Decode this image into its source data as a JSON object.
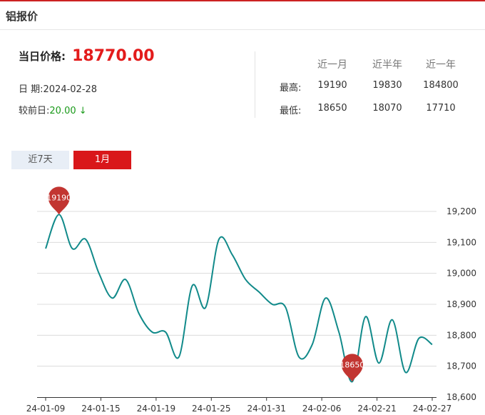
{
  "header": {
    "title": "铝报价"
  },
  "price": {
    "label": "当日价格:",
    "value": "18770.00"
  },
  "date_row": {
    "label": "日 期:",
    "value": "2024-02-28"
  },
  "change_row": {
    "label": "较前日:",
    "value": "20.00 ↓"
  },
  "stats": {
    "headers": [
      "近一月",
      "近半年",
      "近一年"
    ],
    "rows": [
      {
        "label": "最高:",
        "values": [
          "19190",
          "19830",
          "184800"
        ]
      },
      {
        "label": "最低:",
        "values": [
          "18650",
          "18070",
          "17710"
        ]
      }
    ]
  },
  "tabs": [
    {
      "label": "近7天",
      "active": false
    },
    {
      "label": "1月",
      "active": true
    }
  ],
  "colors": {
    "line": "#118a8a",
    "marker": "#c23531",
    "price": "#e31b1b",
    "down": "#1a9a1a",
    "active_tab": "#d9171a"
  },
  "chart_data": {
    "type": "line",
    "x_tick_labels": [
      "24-01-09",
      "24-01-15",
      "24-01-19",
      "24-01-25",
      "24-01-31",
      "24-02-06",
      "24-02-21",
      "24-02-27"
    ],
    "y_tick_labels": [
      "18,600",
      "18,700",
      "18,800",
      "18,900",
      "19,000",
      "19,100",
      "19,200"
    ],
    "ylim": [
      18600,
      19200
    ],
    "grid": true,
    "series": [
      {
        "values": [
          19080,
          19190,
          19080,
          19110,
          19000,
          18920,
          18980,
          18870,
          18810,
          18810,
          18730,
          18960,
          18890,
          19110,
          19060,
          18980,
          18940,
          18900,
          18890,
          18730,
          18770,
          18920,
          18810,
          18650,
          18860,
          18710,
          18850,
          18680,
          18790,
          18770
        ]
      }
    ],
    "markers": [
      {
        "label": "19190",
        "type": "max",
        "index": 1,
        "value": 19190
      },
      {
        "label": "18650",
        "type": "min",
        "index": 23,
        "value": 18650
      }
    ]
  }
}
